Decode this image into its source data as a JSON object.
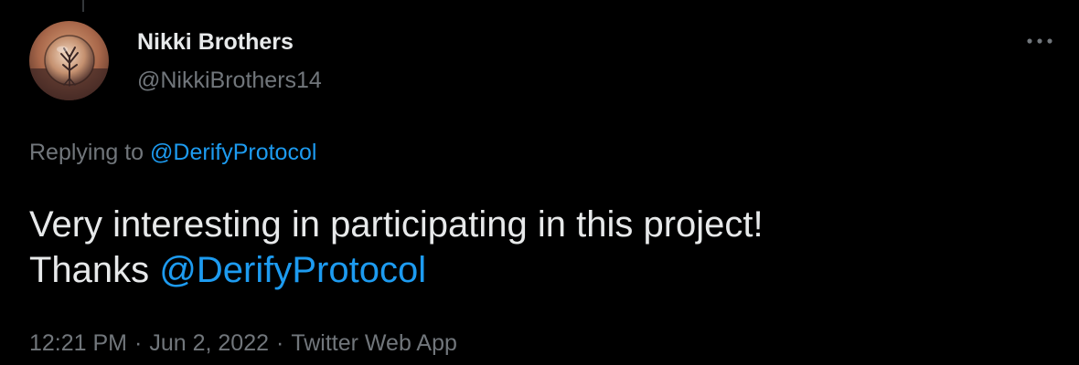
{
  "author": {
    "display_name": "Nikki Brothers",
    "handle": "@NikkiBrothers14",
    "avatar_icon": "crystal-ball-tree-photo"
  },
  "reply_context": {
    "prefix": "Replying to",
    "mention": "@DerifyProtocol"
  },
  "tweet": {
    "line1": "Very interesting in participating in this project!",
    "line2_prefix": "Thanks",
    "line2_mention": "@DerifyProtocol"
  },
  "meta": {
    "time": "12:21 PM",
    "separator": "·",
    "date": "Jun 2, 2022",
    "source": "Twitter Web App"
  },
  "colors": {
    "background": "#000000",
    "primary_text": "#e7e9ea",
    "secondary_text": "#71767b",
    "link": "#1d9bf0"
  },
  "icons": {
    "more_options": "more-horizontal-icon"
  }
}
